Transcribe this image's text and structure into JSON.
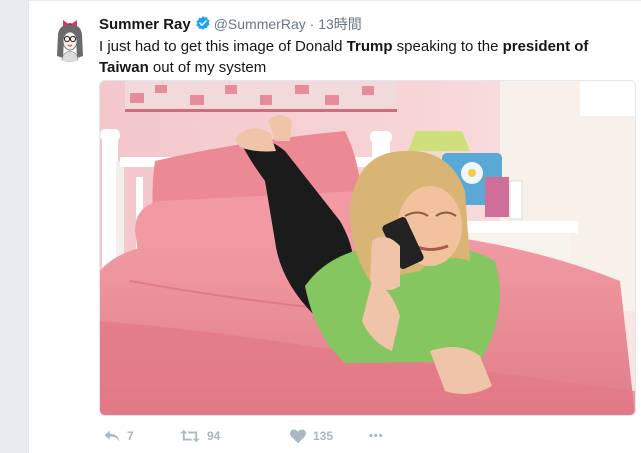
{
  "tweet": {
    "author_name": "Summer Ray",
    "handle": "@SummerRay",
    "separator": "·",
    "time": "13時間",
    "text_parts": {
      "p1": "I just had to get this image of Donald ",
      "b1": "Trump",
      "p2": " speaking to the ",
      "b2": "president of",
      "b3": "Taiwan",
      "p3": " out of my system"
    }
  },
  "actions": {
    "reply_count": "7",
    "retweet_count": "94",
    "like_count": "135",
    "more_label": "•••"
  },
  "colors": {
    "verified": "#1da1f2",
    "action_icon": "#aab8c2",
    "name": "#14171a",
    "meta": "#657786"
  },
  "icons": [
    "verified-badge-icon",
    "reply-icon",
    "retweet-icon",
    "heart-icon",
    "more-icon"
  ]
}
